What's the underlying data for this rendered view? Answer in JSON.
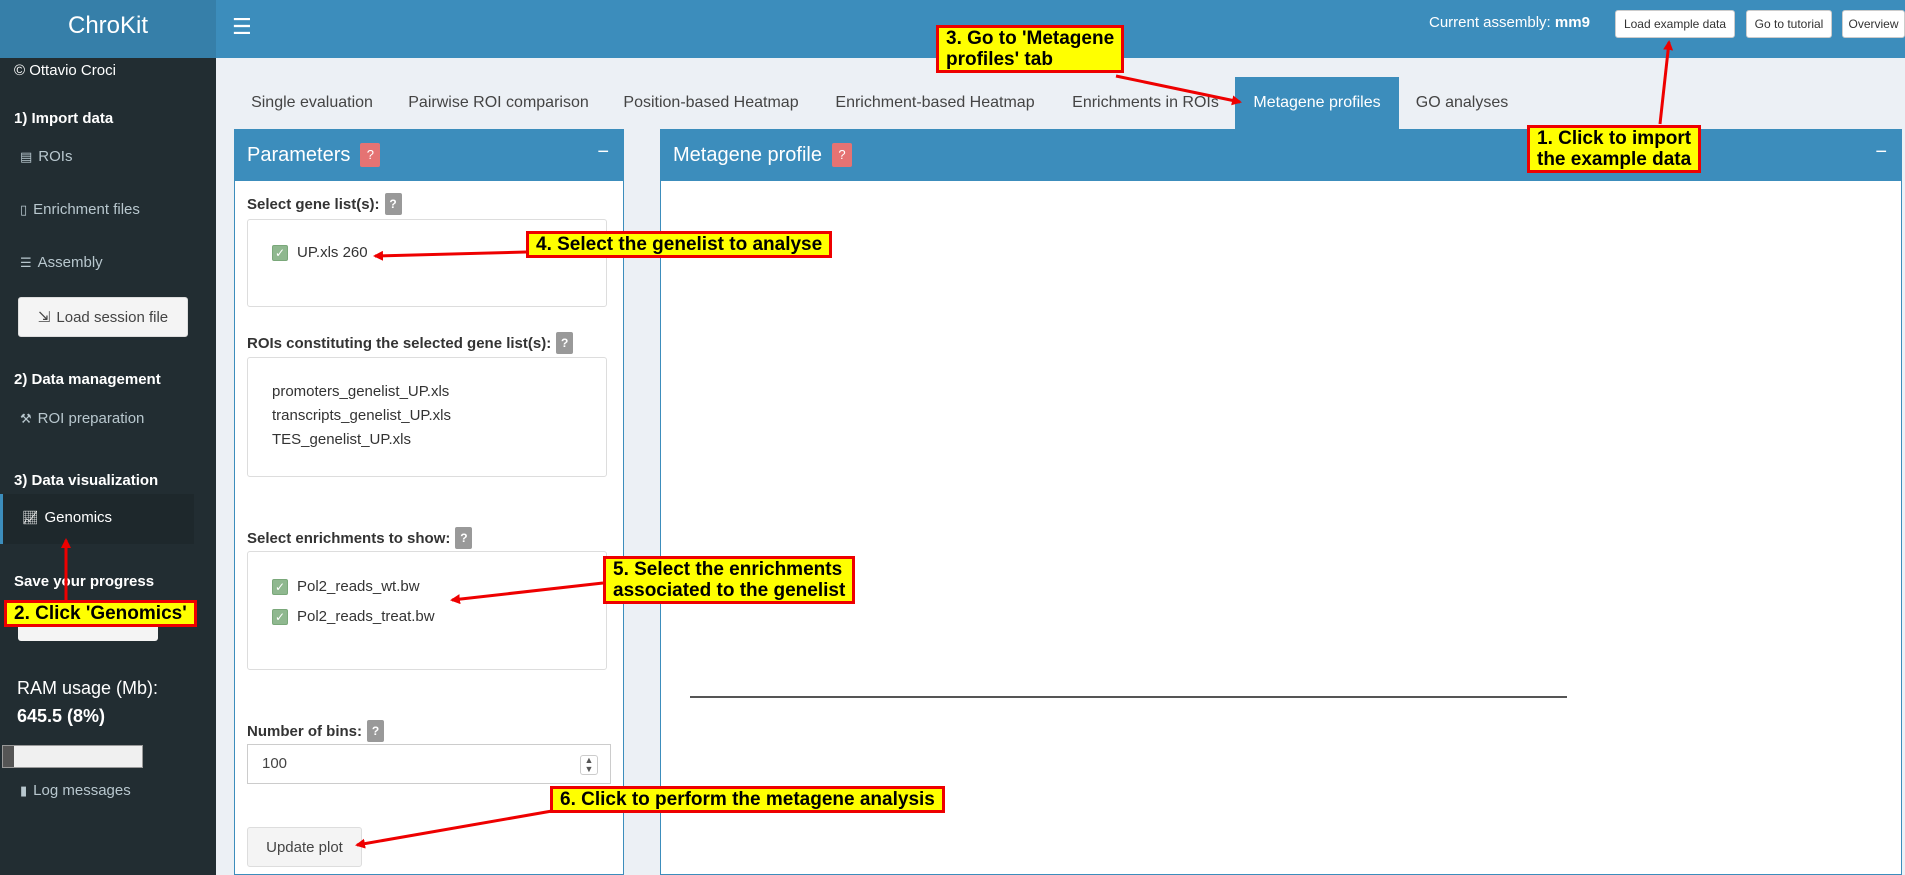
{
  "app": {
    "title": "ChroKit",
    "copyright": "© Ottavio Croci"
  },
  "sidebar": {
    "section1": "1) Import data",
    "rois": "ROIs",
    "enrichment_files": "Enrichment files",
    "assembly": "Assembly",
    "load_session": "Load session file",
    "section2": "2) Data management",
    "roi_preparation": "ROI preparation",
    "section3": "3) Data visualization",
    "genomics": "Genomics",
    "save_progress": "Save your progress",
    "ram_label": "RAM usage (Mb):",
    "ram_value": "645.5 (8%)",
    "ram_fraction": 0.08,
    "log_messages": "Log messages"
  },
  "header": {
    "assembly_label": "Current assembly:",
    "assembly_value": "mm9",
    "load_example": "Load example data",
    "tutorial": "Go to tutorial",
    "overview": "Overview"
  },
  "tabs": [
    {
      "label": "Single evaluation",
      "active": false
    },
    {
      "label": "Pairwise ROI comparison",
      "active": false
    },
    {
      "label": "Position-based Heatmap",
      "active": false
    },
    {
      "label": "Enrichment-based Heatmap",
      "active": false
    },
    {
      "label": "Enrichments in ROIs",
      "active": false
    },
    {
      "label": "Metagene profiles",
      "active": true
    },
    {
      "label": "GO analyses",
      "active": false
    }
  ],
  "params": {
    "title": "Parameters",
    "help": "?",
    "select_genelist": "Select gene list(s):",
    "genelist_item": "UP.xls 260",
    "rois_label": "ROIs constituting the selected gene list(s):",
    "rois": [
      "promoters_genelist_UP.xls",
      "transcripts_genelist_UP.xls",
      "TES_genelist_UP.xls"
    ],
    "enrich_label": "Select enrichments to show:",
    "enrichments": [
      "Pol2_reads_wt.bw",
      "Pol2_reads_treat.bw"
    ],
    "bins_label": "Number of bins:",
    "bins_value": "100",
    "update_button": "Update plot"
  },
  "plot": {
    "title": "Metagene profile",
    "help": "?"
  },
  "annotations": {
    "a1": "1. Click to import\nthe example data",
    "a2": "2. Click 'Genomics'",
    "a3": "3. Go to 'Metagene\nprofiles' tab",
    "a4": "4. Select the genelist to analyse",
    "a5": "5. Select the enrichments\nassociated to the genelist",
    "a6": "6. Click to perform the metagene analysis"
  },
  "colors": {
    "header": "#3c8dbc",
    "logo": "#367fa9",
    "sidebar": "#222d32",
    "annotation_bg": "#ffff00",
    "annotation_border": "#ee0000"
  }
}
